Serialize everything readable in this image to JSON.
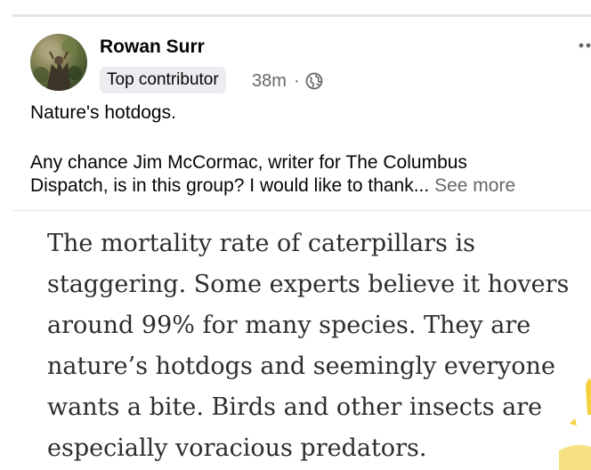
{
  "post": {
    "author": "Rowan Surr",
    "badge": "Top contributor",
    "time": "38m",
    "separator": "·",
    "privacy_icon": "globe-icon",
    "menu_icon": "more-options-icon",
    "text_line1": "Nature's hotdogs.",
    "text_line2": "Any chance Jim McCormac, writer for The Columbus",
    "text_line3": "Dispatch, is in this group? I would like to thank...",
    "see_more": "See more"
  },
  "image": {
    "quote_lines": [
      "The mortality rate of caterpillars is",
      "staggering. Some experts believe it hovers",
      "around 99% for many species. They are",
      "nature’s hotdogs and seemingly everyone",
      "wants a bite. Birds and other insects are",
      "especially voracious predators."
    ]
  },
  "colors": {
    "primary_text": "#050505",
    "secondary_text": "#65676b",
    "badge_bg": "#ebedf0",
    "divider": "#e4e6eb",
    "quote_text": "#2d2d2d",
    "highlight": "#f4d03f"
  }
}
